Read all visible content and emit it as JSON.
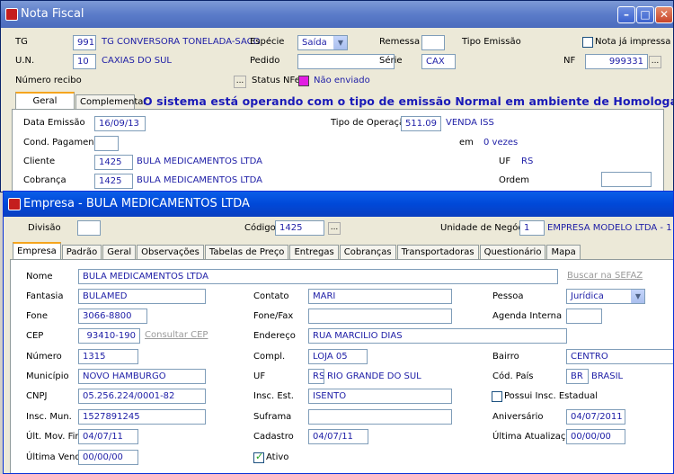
{
  "nf": {
    "title": "Nota Fiscal",
    "tg_label": "TG",
    "tg_code": "991",
    "tg_name": "TG CONVERSORA TONELADA-SACO",
    "especie_label": "Espécie",
    "especie_value": "Saída",
    "remessa_label": "Remessa",
    "remessa_value": "",
    "tipo_emissao_label": "Tipo Emissão",
    "nota_impressa_label": "Nota já impressa",
    "un_label": "U.N.",
    "un_code": "10",
    "un_name": "CAXIAS DO SUL",
    "pedido_label": "Pedido",
    "pedido_value": "",
    "serie_label": "Série",
    "serie_value": "CAX",
    "nf_label": "NF",
    "nf_value": "999331",
    "numero_recibo_label": "Número recibo",
    "status_nfe_label": "Status NFe",
    "status_nfe_value": "Não enviado",
    "tabs": [
      "Geral",
      "Complementar"
    ],
    "notice": "O sistema está operando com o tipo de emissão Normal em ambiente de Homologação",
    "data_emissao_label": "Data Emissão",
    "data_emissao_value": "16/09/13",
    "tipo_operacao_label": "Tipo de Operação",
    "tipo_operacao_code": "511.09",
    "tipo_operacao_name": "VENDA ISS",
    "cond_pagamento_label": "Cond. Pagamento",
    "em_label": "em",
    "vezes_value": "0 vezes",
    "cliente_label": "Cliente",
    "cliente_code": "1425",
    "cliente_name": "BULA MEDICAMENTOS LTDA",
    "uf_label": "UF",
    "uf_value": "RS",
    "cobranca_label": "Cobrança",
    "cobranca_code": "1425",
    "cobranca_name": "BULA MEDICAMENTOS LTDA",
    "ordem_label": "Ordem",
    "ordem_value": ""
  },
  "emp": {
    "title": "Empresa - BULA MEDICAMENTOS LTDA",
    "divisao_label": "Divisão",
    "divisao_value": "",
    "codigo_label": "Código",
    "codigo_value": "1425",
    "unidade_label": "Unidade de Negócio",
    "unidade_code": "1",
    "unidade_name": "EMPRESA MODELO LTDA - 1",
    "tabs": [
      "Empresa",
      "Padrão",
      "Geral",
      "Observações",
      "Tabelas de Preço",
      "Entregas",
      "Cobranças",
      "Transportadoras",
      "Questionário",
      "Mapa"
    ],
    "nome_label": "Nome",
    "nome_value": "BULA MEDICAMENTOS LTDA",
    "buscar_sefaz": "Buscar na SEFAZ",
    "fantasia_label": "Fantasia",
    "fantasia_value": "BULAMED",
    "contato_label": "Contato",
    "contato_value": "MARI",
    "pessoa_label": "Pessoa",
    "pessoa_value": "Jurídica",
    "fone_label": "Fone",
    "fone_value": "3066-8800",
    "fonefax_label": "Fone/Fax",
    "fonefax_value": "",
    "agenda_label": "Agenda Interna",
    "agenda_value": "",
    "cep_label": "CEP",
    "cep_value": "93410-190",
    "consultar_cep": "Consultar CEP",
    "endereco_label": "Endereço",
    "endereco_value": "RUA MARCILIO DIAS",
    "numero_label": "Número",
    "numero_value": "1315",
    "compl_label": "Compl.",
    "compl_value": "LOJA 05",
    "bairro_label": "Bairro",
    "bairro_value": "CENTRO",
    "municipio_label": "Município",
    "municipio_value": "NOVO HAMBURGO",
    "uf_label": "UF",
    "uf_code": "RS",
    "uf_name": "RIO GRANDE DO SUL",
    "cod_pais_label": "Cód. País",
    "cod_pais_code": "BR",
    "cod_pais_name": "BRASIL",
    "cnpj_label": "CNPJ",
    "cnpj_value": "05.256.224/0001-82",
    "insc_est_label": "Insc. Est.",
    "insc_est_value": "ISENTO",
    "possui_label": "Possui Insc. Estadual",
    "insc_mun_label": "Insc. Mun.",
    "insc_mun_value": "1527891245",
    "suframa_label": "Suframa",
    "suframa_value": "",
    "aniversario_label": "Aniversário",
    "aniversario_value": "04/07/2011",
    "ult_mov_label": "Últ. Mov. Fin.",
    "ult_mov_value": "04/07/11",
    "cadastro_label": "Cadastro",
    "cadastro_value": "04/07/11",
    "ultima_atualizacao_label": "Última Atualização",
    "ultima_atualizacao_value": "00/00/00",
    "ultima_venda_label": "Última Venda",
    "ultima_venda_value": "00/00/00",
    "ativo_label": "Ativo"
  }
}
